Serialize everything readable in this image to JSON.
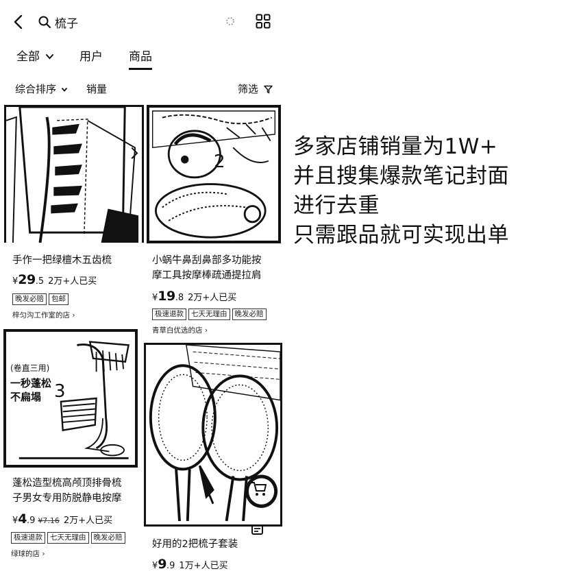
{
  "search": {
    "query": "梳子"
  },
  "tabs": [
    {
      "label": "全部",
      "active": false
    },
    {
      "label": "用户",
      "active": false
    },
    {
      "label": "商品",
      "active": true
    }
  ],
  "sort": {
    "comprehensive": "综合排序",
    "sales": "销量",
    "filter": "筛选"
  },
  "products": [
    {
      "title": "手作一把绿檀木五齿梳",
      "price_symbol": "¥",
      "price_int": "29",
      "price_dec": ".5",
      "sold": "2万+人已买",
      "tags": [
        "晚发必赔",
        "包邮"
      ],
      "shop": "梓匀沟工作室的店 ›"
    },
    {
      "title_line1": "小蜗牛鼻刮鼻部多功能按",
      "title_line2": "摩工具按摩棒疏通提拉肩",
      "price_symbol": "¥",
      "price_int": "19",
      "price_dec": ".8",
      "sold": "2万+人已买",
      "tags": [
        "极速退款",
        "七天无理由",
        "晚发必赔"
      ],
      "shop": "青草白优选的店 ›",
      "image_number": "2"
    },
    {
      "image_caption_small": "(卷直三用)",
      "image_caption_1": "一秒蓬松",
      "image_caption_2": "不扁塌",
      "image_number": "3",
      "title_line1": "蓬松造型梳高颅顶排骨梳",
      "title_line2": "子男女专用防脱静电按摩",
      "price_symbol": "¥",
      "price_int": "4",
      "price_dec": ".9",
      "old_price": "¥7.16",
      "sold": "2万+人已买",
      "tags": [
        "极速退款",
        "七天无理由",
        "晚发必赔"
      ],
      "shop": "绿球的店 ›"
    },
    {
      "title": "好用的2把梳子套装",
      "price_symbol": "¥",
      "price_int": "9",
      "price_dec": ".9",
      "sold": "1万+人已买"
    }
  ],
  "overlay": {
    "line1": "多家店铺销量为1W+",
    "line2": "并且搜集爆款笔记封面",
    "line3": "进行去重",
    "line4": "只需跟品就可实现出单"
  }
}
